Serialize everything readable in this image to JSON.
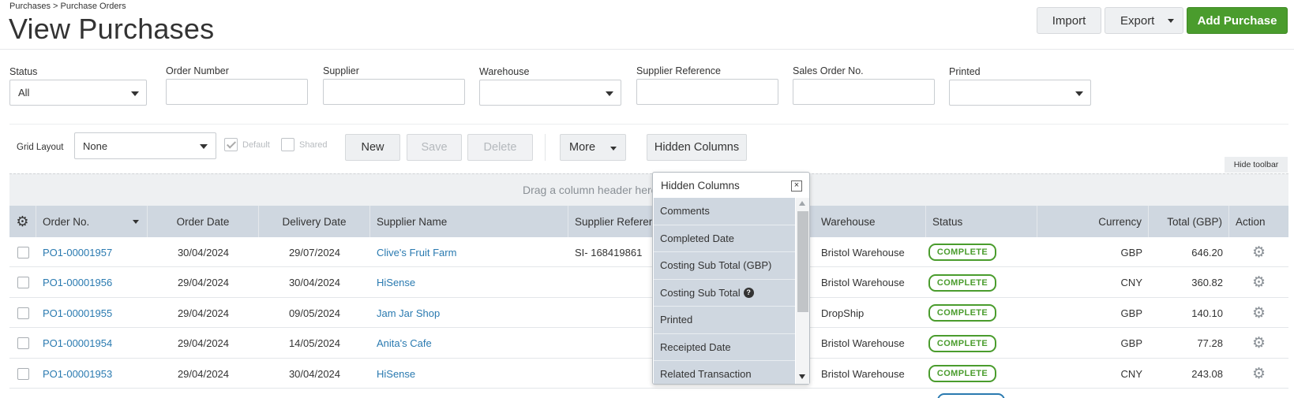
{
  "breadcrumb": "Purchases > Purchase Orders",
  "page_title": "View Purchases",
  "header_buttons": {
    "import": "Import",
    "export": "Export",
    "add": "Add Purchase"
  },
  "filters": [
    {
      "label": "Status",
      "value": "All",
      "type": "select"
    },
    {
      "label": "Order Number",
      "value": "",
      "type": "input"
    },
    {
      "label": "Supplier",
      "value": "",
      "type": "input"
    },
    {
      "label": "Warehouse",
      "value": "",
      "type": "select"
    },
    {
      "label": "Supplier Reference",
      "value": "",
      "type": "input"
    },
    {
      "label": "Sales Order No.",
      "value": "",
      "type": "input"
    },
    {
      "label": "Printed",
      "value": "",
      "type": "select"
    }
  ],
  "toolbar": {
    "grid_layout_label": "Grid Layout",
    "grid_layout_value": "None",
    "default_label": "Default",
    "shared_label": "Shared",
    "new": "New",
    "save": "Save",
    "delete": "Delete",
    "more": "More",
    "hidden_columns": "Hidden Columns",
    "hide_toolbar": "Hide toolbar"
  },
  "drag_text": "Drag a column header here",
  "columns": {
    "order_no": "Order No.",
    "order_date": "Order Date",
    "delivery_date": "Delivery Date",
    "supplier_name": "Supplier Name",
    "supplier_reference": "Supplier Reference",
    "warehouse": "Warehouse",
    "status": "Status",
    "currency": "Currency",
    "total": "Total (GBP)",
    "action": "Action"
  },
  "rows": [
    {
      "order_no": "PO1-00001957",
      "order_date": "30/04/2024",
      "delivery_date": "29/07/2024",
      "supplier": "Clive's Fruit Farm",
      "supplier_ref": "SI- 168419861",
      "warehouse": "Bristol Warehouse",
      "status": "COMPLETE",
      "currency": "GBP",
      "total": "646.20"
    },
    {
      "order_no": "PO1-00001956",
      "order_date": "29/04/2024",
      "delivery_date": "30/04/2024",
      "supplier": "HiSense",
      "supplier_ref": "",
      "warehouse": "Bristol Warehouse",
      "status": "COMPLETE",
      "currency": "CNY",
      "total": "360.82"
    },
    {
      "order_no": "PO1-00001955",
      "order_date": "29/04/2024",
      "delivery_date": "09/05/2024",
      "supplier": "Jam Jar Shop",
      "supplier_ref": "",
      "warehouse": "DropShip",
      "status": "COMPLETE",
      "currency": "GBP",
      "total": "140.10"
    },
    {
      "order_no": "PO1-00001954",
      "order_date": "29/04/2024",
      "delivery_date": "14/05/2024",
      "supplier": "Anita's Cafe",
      "supplier_ref": "",
      "warehouse": "Bristol Warehouse",
      "status": "COMPLETE",
      "currency": "GBP",
      "total": "77.28"
    },
    {
      "order_no": "PO1-00001953",
      "order_date": "29/04/2024",
      "delivery_date": "30/04/2024",
      "supplier": "HiSense",
      "supplier_ref": "",
      "warehouse": "Bristol Warehouse",
      "status": "COMPLETE",
      "currency": "CNY",
      "total": "243.08"
    }
  ],
  "hidden_columns_popup": {
    "title": "Hidden Columns",
    "close": "×",
    "items": [
      "Comments",
      "Completed Date",
      "Costing Sub Total (GBP)",
      "Costing Sub Total",
      "Printed",
      "Receipted Date",
      "Related Transaction"
    ],
    "help_icon_item_index": 3
  },
  "colors": {
    "accent_green": "#4a9c2d",
    "link_blue": "#2a7ab0",
    "header_bg": "#cfd7e0"
  }
}
